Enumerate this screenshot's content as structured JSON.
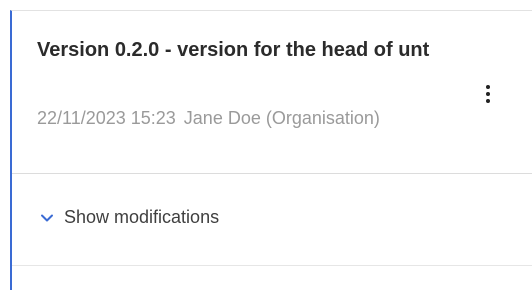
{
  "version": {
    "title": "Version 0.2.0 - version for the head of unt",
    "date": "22/11/2023 15:23",
    "author": "Jane Doe (Organisation)"
  },
  "actions": {
    "menu_icon": "kebab-vertical-icon"
  },
  "modifications": {
    "toggle_label": "Show modifications",
    "toggle_icon": "chevron-down-icon"
  },
  "colors": {
    "accent": "#3a6bd4",
    "title": "#2b2b2b",
    "meta": "#9a9a9a"
  }
}
